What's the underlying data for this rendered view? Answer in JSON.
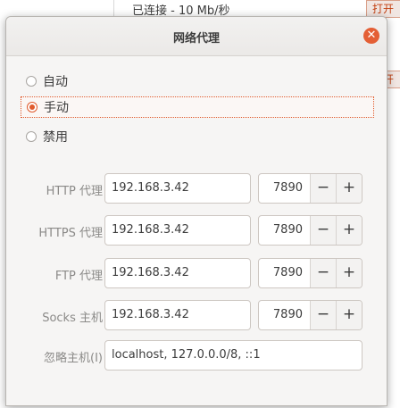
{
  "background": {
    "status_text": "已连接 - 10 Mb/秒",
    "open_button_1": "打开",
    "open_button_2": "打开"
  },
  "dialog": {
    "title": "网络代理",
    "close_icon": "close-icon",
    "modes": [
      {
        "label": "自动",
        "selected": false
      },
      {
        "label": "手动",
        "selected": true
      },
      {
        "label": "禁用",
        "selected": false
      }
    ],
    "proxies": [
      {
        "label": "HTTP 代理",
        "host": "192.168.3.42",
        "port": "7890"
      },
      {
        "label": "HTTPS 代理",
        "host": "192.168.3.42",
        "port": "7890"
      },
      {
        "label": "FTP 代理",
        "host": "192.168.3.42",
        "port": "7890"
      },
      {
        "label": "Socks 主机",
        "host": "192.168.3.42",
        "port": "7890"
      }
    ],
    "ignore_hosts": {
      "label": "忽略主机(I)",
      "value": "localhost, 127.0.0.0/8, ::1"
    },
    "minus_symbol": "−",
    "plus_symbol": "+"
  },
  "colors": {
    "accent": "#e05a2c",
    "close": "#e45f35"
  }
}
